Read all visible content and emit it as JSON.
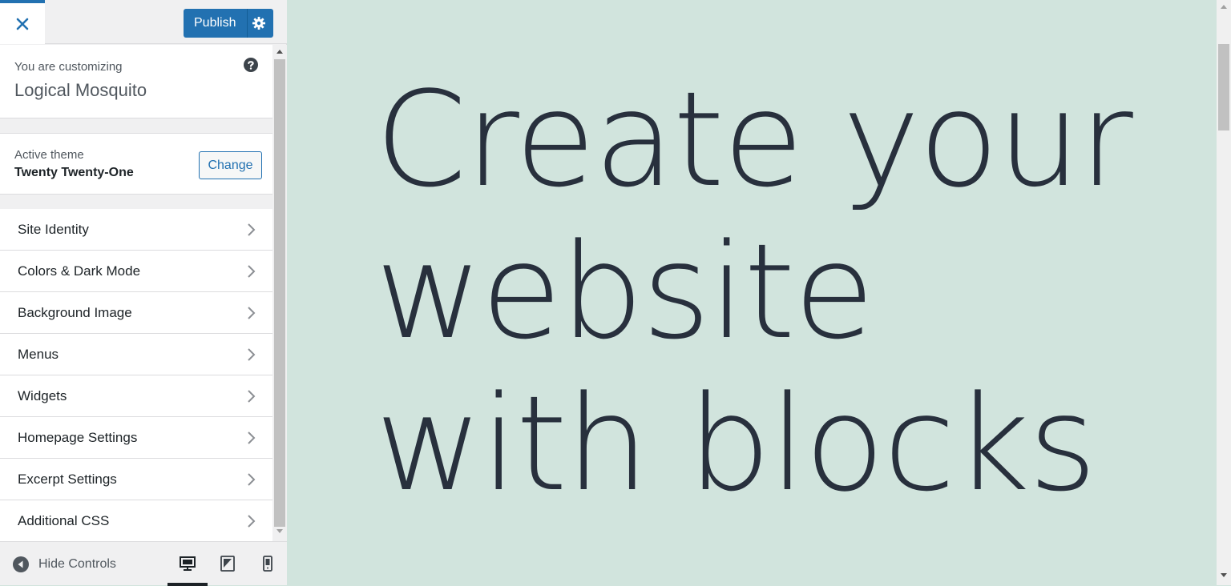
{
  "header": {
    "close_icon": "close-icon",
    "publish_label": "Publish",
    "publish_settings_icon": "gear-icon",
    "accent_color": "#2271b1"
  },
  "customizing": {
    "kicker": "You are customizing",
    "site_title": "Logical Mosquito",
    "help_icon": "help-icon"
  },
  "theme": {
    "kicker": "Active theme",
    "name": "Twenty Twenty-One",
    "change_label": "Change"
  },
  "menu": {
    "items": [
      {
        "label": "Site Identity"
      },
      {
        "label": "Colors & Dark Mode"
      },
      {
        "label": "Background Image"
      },
      {
        "label": "Menus"
      },
      {
        "label": "Widgets"
      },
      {
        "label": "Homepage Settings"
      },
      {
        "label": "Excerpt Settings"
      },
      {
        "label": "Additional CSS"
      }
    ]
  },
  "footer": {
    "hide_controls_label": "Hide Controls",
    "devices": [
      {
        "name": "desktop",
        "active": true
      },
      {
        "name": "tablet",
        "active": false
      },
      {
        "name": "mobile",
        "active": false
      }
    ]
  },
  "preview": {
    "headline": "Create your website with blocks",
    "background_color": "#d1e4dd",
    "text_color": "#28303d"
  }
}
